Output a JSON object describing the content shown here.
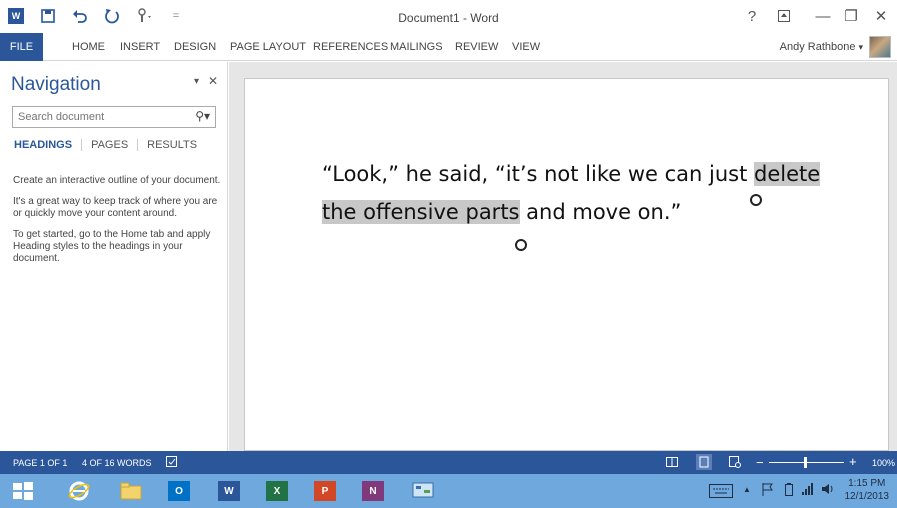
{
  "window": {
    "title": "Document1 - Word",
    "controls": {
      "help": "?",
      "ribbon_display": "⇧",
      "minimize": "—",
      "restore": "❐",
      "close": "✕"
    }
  },
  "quick_access": {
    "word_icon": "W",
    "customize": "="
  },
  "ribbon": {
    "tabs": [
      "FILE",
      "HOME",
      "INSERT",
      "DESIGN",
      "PAGE LAYOUT",
      "REFERENCES",
      "MAILINGS",
      "REVIEW",
      "VIEW"
    ],
    "user_name": "Andy Rathbone",
    "user_caret": "▾"
  },
  "navigation": {
    "title": "Navigation",
    "options_glyph": "▾",
    "close_glyph": "✕",
    "search_placeholder": "Search document",
    "search_glyph": "⚲▾",
    "tabs": [
      "HEADINGS",
      "PAGES",
      "RESULTS"
    ],
    "paragraphs": [
      "Create an interactive outline of your document.",
      "It's a great way to keep track of where you are or quickly move your content around.",
      "To get started, go to the Home tab and apply Heading styles to the headings in your document."
    ]
  },
  "document": {
    "text_before": "“Look,” he said, “it’s not like we can just ",
    "selected_text_1": "delete",
    "selected_text_2": "the offensive parts",
    "text_after": " and move on.”"
  },
  "status": {
    "page": "PAGE 1 OF 1",
    "words": "4 OF 16 WORDS",
    "zoom": "100%",
    "zoom_minus": "−",
    "zoom_plus": "+",
    "zoom_level": 100
  },
  "taskbar": {
    "apps": [
      "start",
      "internet-explorer",
      "file-explorer",
      "outlook",
      "word",
      "excel",
      "powerpoint",
      "onenote",
      "control-panel"
    ],
    "app_letters": {
      "outlook": "O",
      "word": "W",
      "excel": "X",
      "powerpoint": "P",
      "onenote": "N"
    },
    "tray_caret": "▲",
    "time": "1:15 PM",
    "date": "12/1/2013"
  },
  "colors": {
    "accent": "#2b579a",
    "taskbar": "#6fa8dc",
    "selection": "#c8c8c8"
  }
}
